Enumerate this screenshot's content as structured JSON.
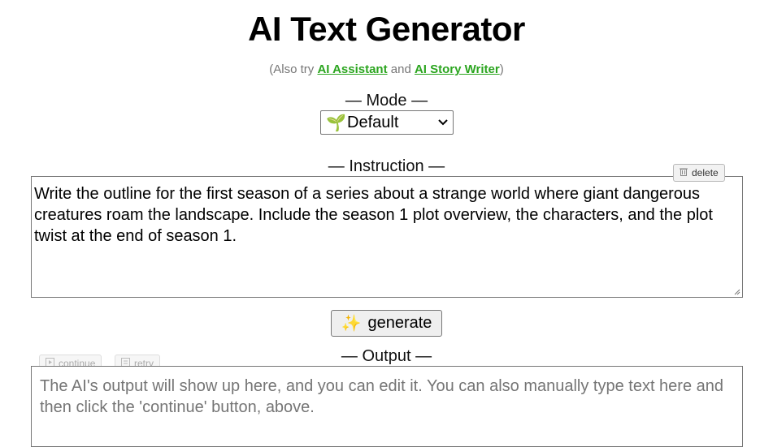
{
  "header": {
    "title": "AI Text Generator",
    "subtitle_prefix": "(Also try ",
    "link1": "AI Assistant",
    "subtitle_and": " and ",
    "link2": "AI Story Writer",
    "subtitle_suffix": ")"
  },
  "mode": {
    "label": "— Mode —",
    "icon": "🌱",
    "selected": "Default"
  },
  "instruction": {
    "label": "— Instruction —",
    "delete_label": "delete",
    "text": "Write the outline for the first season of a series about a strange world where giant dangerous creatures roam the landscape. Include the season 1 plot overview, the characters, and the plot twist at the end of season 1."
  },
  "generate": {
    "icon": "✨",
    "label": "generate"
  },
  "output": {
    "label": "— Output —",
    "continue_label": "continue",
    "retry_label": "retry",
    "placeholder": "The AI's output will show up here, and you can edit it. You can also manually type text here and then click the 'continue' button, above."
  },
  "colors": {
    "link": "#2ba51f",
    "subtitle": "#777777",
    "placeholder": "#757575"
  }
}
